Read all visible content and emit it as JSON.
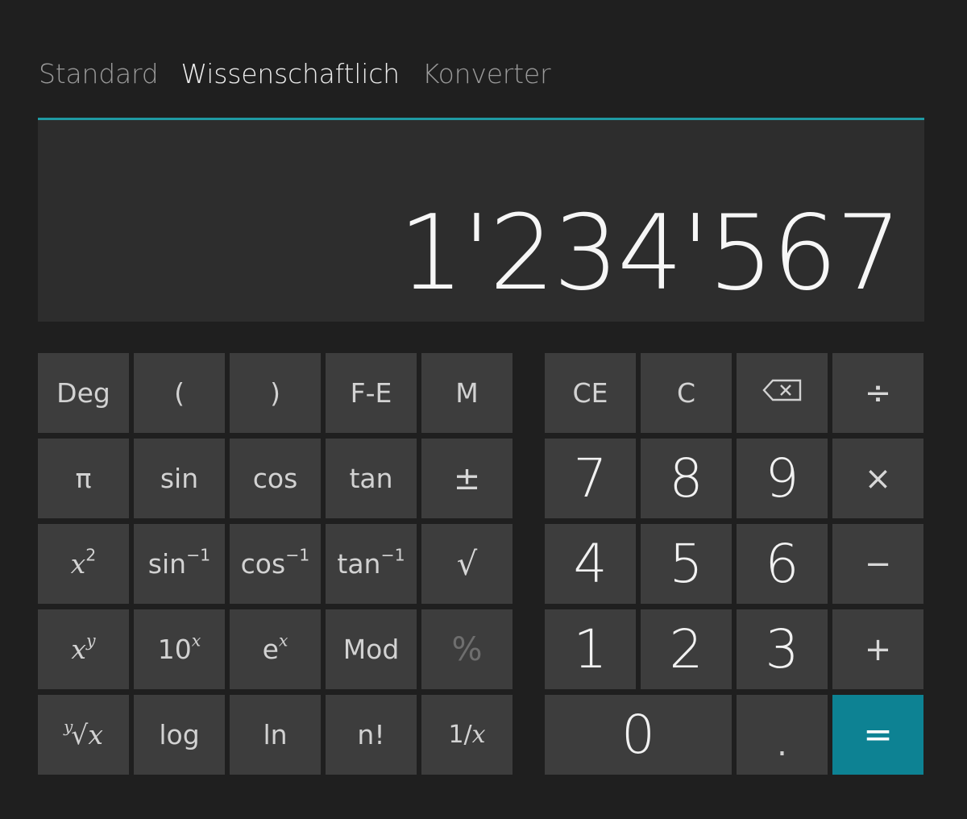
{
  "tabs": {
    "standard": "Standard",
    "scientific": "Wissenschaftlich",
    "converter": "Konverter"
  },
  "display": {
    "value": "1'234'567"
  },
  "accent_color": "#1f9aa3",
  "equals_color": "#0d8293",
  "sci": {
    "deg": "Deg",
    "open_paren": "(",
    "close_paren": ")",
    "fe": "F-E",
    "memory": "M",
    "pi": "π",
    "sin": "sin",
    "cos": "cos",
    "tan": "tan",
    "plus_minus": "±",
    "x_base": "x",
    "square_exp": "2",
    "asin_base": "sin",
    "acos_base": "cos",
    "atan_base": "tan",
    "inverse_exp": "−1",
    "sqrt": "√",
    "xy_exp": "y",
    "ten_base": "10",
    "x_exp": "x",
    "e_base": "e",
    "mod": "Mod",
    "percent": "%",
    "root_index": "y",
    "root_sign": "√",
    "log": "log",
    "ln": "ln",
    "factorial": "n!",
    "reciprocal_num": "1/",
    "reciprocal_var": "x"
  },
  "std": {
    "ce": "CE",
    "c": "C",
    "backspace_icon": "backspace-icon",
    "divide": "÷",
    "multiply": "×",
    "minus": "−",
    "plus": "+",
    "equals": "=",
    "decimal": ".",
    "d0": "0",
    "d1": "1",
    "d2": "2",
    "d3": "3",
    "d4": "4",
    "d5": "5",
    "d6": "6",
    "d7": "7",
    "d8": "8",
    "d9": "9"
  }
}
